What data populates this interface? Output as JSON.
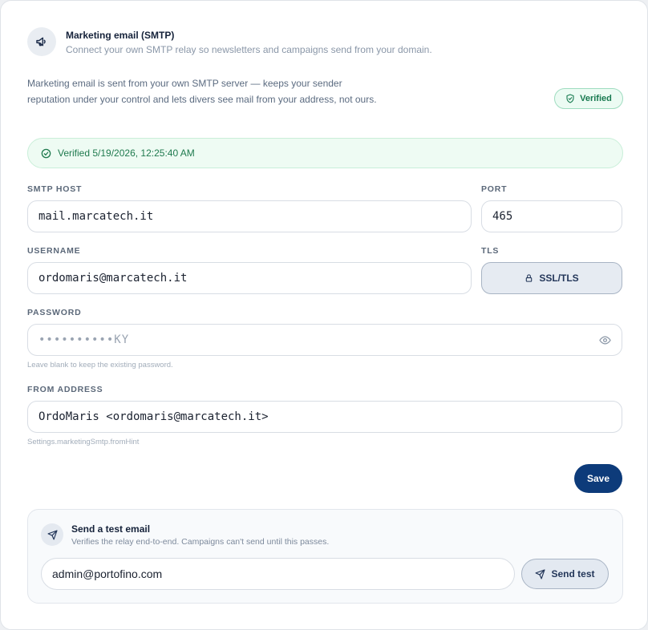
{
  "header": {
    "icon": "megaphone-icon",
    "title": "Marketing email (SMTP)",
    "subtitle": "Connect your own SMTP relay so newsletters and campaigns send from your domain."
  },
  "description": "Marketing email is sent from your own SMTP server — keeps your sender reputation under your control and lets divers see mail from your address, not ours.",
  "status_badge": {
    "label": "Verified",
    "icon": "shield-check-icon",
    "color": "#17794f"
  },
  "verified_banner": {
    "icon": "check-circle-icon",
    "text": "Verified 5/19/2026, 12:25:40 AM"
  },
  "form": {
    "smtp_host": {
      "label": "SMTP HOST",
      "value": "mail.marcatech.it"
    },
    "port": {
      "label": "PORT",
      "value": "465"
    },
    "username": {
      "label": "USERNAME",
      "value": "ordomaris@marcatech.it"
    },
    "tls": {
      "label": "TLS",
      "value": "SSL/TLS",
      "icon": "lock-icon"
    },
    "password": {
      "label": "PASSWORD",
      "placeholder": "••••••••••KY",
      "hint": "Leave blank to keep the existing password.",
      "toggle_icon": "eye-icon"
    },
    "from_address": {
      "label": "FROM ADDRESS",
      "value": "OrdoMaris <ordomaris@marcatech.it>",
      "hint": "Settings.marketingSmtp.fromHint"
    },
    "save_label": "Save"
  },
  "test_email": {
    "icon": "send-icon",
    "title": "Send a test email",
    "subtitle": "Verifies the relay end-to-end. Campaigns can't send until this passes.",
    "recipient": "admin@portofino.com",
    "button_label": "Send test"
  },
  "colors": {
    "accent": "#0d3b7a",
    "success": "#17794f"
  }
}
